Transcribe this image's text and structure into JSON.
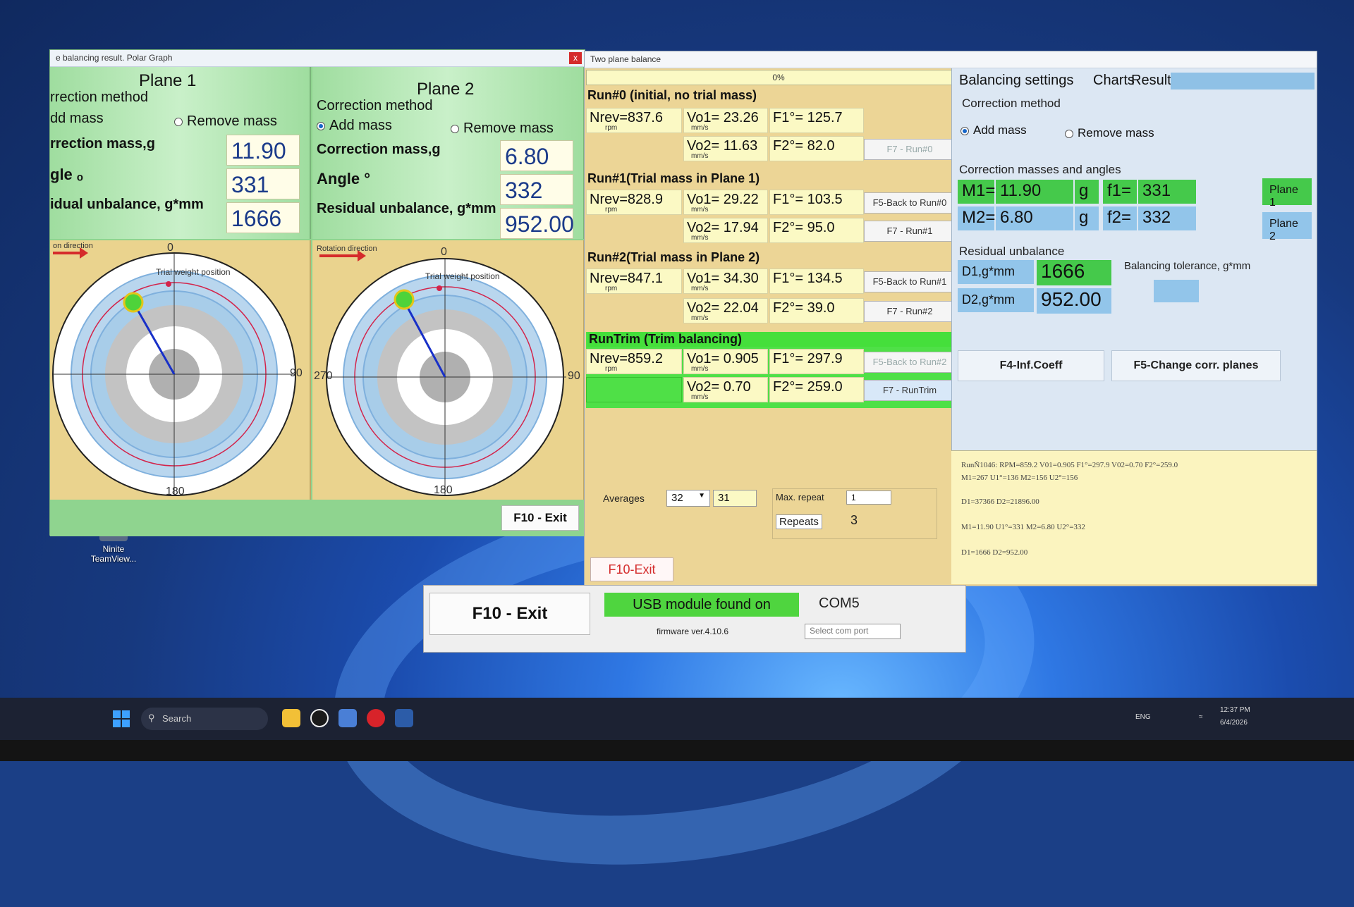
{
  "desktop": {
    "icon_label": "Ninite TeamView..."
  },
  "polar_window": {
    "title": "e balancing result. Polar Graph",
    "close_label": "x",
    "plane1": {
      "title": "Plane 1",
      "correction_method_label": "rrection method",
      "add_mass_label": "dd mass",
      "remove_mass_label": "Remove mass",
      "mass_label": "rrection mass,g",
      "angle_label": "gle ₒ",
      "residual_label": "idual unbalance, g*mm",
      "mass_value": "11.90",
      "angle_value": "331",
      "residual_value": "1666",
      "rotation_label": "on direction",
      "trial_label": "Trial weight position",
      "angle_top": "0",
      "angle_right": "90",
      "angle_bottom": "180"
    },
    "plane2": {
      "title": "Plane 2",
      "correction_method_label": "Correction method",
      "add_mass_label": "Add mass",
      "remove_mass_label": "Remove mass",
      "mass_label": "Correction mass,g",
      "angle_label": "Angle °",
      "residual_label": "Residual unbalance, g*mm",
      "mass_value": "6.80",
      "angle_value": "332",
      "residual_value": "952.00",
      "rotation_label": "Rotation direction",
      "trial_label": "Trial weight position",
      "angle_top": "0",
      "angle_left": "270",
      "angle_right": "90",
      "angle_bottom": "180"
    },
    "exit_label": "F10 - Exit"
  },
  "twoplane_window": {
    "title": "Two plane balance",
    "progress": "0%",
    "runs": [
      {
        "head": "Run#0 (initial, no trial mass)",
        "nrev": "Nrev=837.6",
        "vo1": "Vo1= 23.26",
        "f1": "F1°= 125.7",
        "vo2": "Vo2= 11.63",
        "f2": "F2°= 82.0",
        "btn2": "F7 - Run#0"
      },
      {
        "head": "Run#1(Trial mass in Plane 1)",
        "nrev": "Nrev=828.9",
        "vo1": "Vo1= 29.22",
        "f1": "F1°= 103.5",
        "vo2": "Vo2= 17.94",
        "f2": "F2°= 95.0",
        "btn1": "F5-Back to Run#0",
        "btn2": "F7 - Run#1"
      },
      {
        "head": "Run#2(Trial mass in Plane 2)",
        "nrev": "Nrev=847.1",
        "vo1": "Vo1= 34.30",
        "f1": "F1°= 134.5",
        "vo2": "Vo2= 22.04",
        "f2": "F2°= 39.0",
        "btn1": "F5-Back to Run#1",
        "btn2": "F7 - Run#2"
      },
      {
        "head": "RunTrim (Trim balancing)",
        "nrev": "Nrev=859.2",
        "vo1": "Vo1= 0.905",
        "f1": "F1°= 297.9",
        "vo2": "Vo2= 0.70",
        "f2": "F2°= 259.0",
        "btn1": "F5-Back to Run#2",
        "btn2": "F7 - RunTrim"
      }
    ],
    "unit_rpm": "rpm",
    "unit_mms": "mm/s",
    "averages_label": "Averages",
    "averages_value": "32",
    "averages_value2": "31",
    "max_repeat_label": "Max. repeat",
    "max_repeat_value": "1",
    "repeats_label": "Repeats",
    "repeats_value": "3",
    "exit_label": "F10-Exit",
    "tabs": [
      "Balancing settings",
      "Charts",
      "Result"
    ],
    "correction_method_label": "Correction method",
    "add_mass_label": "Add mass",
    "remove_mass_label": "Remove mass",
    "masses_angles_label": "Correction masses and angles",
    "m1_label": "M1=",
    "m1_value": "11.90",
    "g1": "g",
    "f1_label": "f1=",
    "f1_value": "331",
    "m2_label": "M2=",
    "m2_value": "6.80",
    "g2": "g",
    "f2_label": "f2=",
    "f2_value": "332",
    "plane1_btn": "Plane 1",
    "plane2_btn": "Plane 2",
    "residual_label": "Residual unbalance",
    "d1_label": "D1,g*mm",
    "d1_value": "1666",
    "d2_label": "D2,g*mm",
    "d2_value": "952.00",
    "tolerance_label": "Balancing tolerance, g*mm",
    "f4_label": "F4-Inf.Coeff",
    "f5_label": "F5-Change corr. planes",
    "log": [
      "RunÑ1046: RPM=859.2 V01=0.905 F1°=297.9 V02=0.70 F2°=259.0",
      "M1=267 U1°=136 M2=156 U2°=156",
      "D1=37366 D2=21896.00",
      "M1=11.90 U1°=331 M2=6.80 U2°=332",
      "D1=1666 D2=952.00"
    ]
  },
  "host": {
    "exit_label": "F10 - Exit",
    "usb_status": "USB module found on",
    "com_port": "COM5",
    "firmware": "firmware ver.4.10.6",
    "select_port": "Select com port"
  },
  "taskbar": {
    "search": "Search",
    "lang": "ENG",
    "time": "12:37 PM",
    "date": "6/4/2026"
  },
  "colors": {
    "panel_green": "#9fdd9f",
    "run_yellow": "#fbf9c4",
    "accent_green": "#4fe047",
    "accent_blue": "#92c5ea"
  }
}
